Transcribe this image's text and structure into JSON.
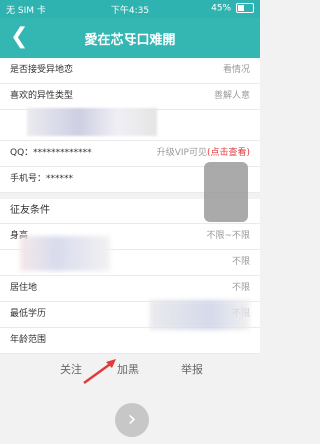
{
  "status": {
    "carrier": "无 SIM 卡",
    "time": "下午4:35",
    "battery": "45%"
  },
  "header": {
    "back_icon": "chevron-left",
    "title": "愛在芯㸦口难開"
  },
  "profile": {
    "rows": [
      {
        "label": "是否接受异地恋",
        "value": "看情况"
      },
      {
        "label": "喜欢的异性类型",
        "value": "善解人意"
      }
    ]
  },
  "contact": {
    "qq_label": "QQ：*************",
    "qq_upgrade": "升级VIP可见",
    "qq_link": "(点击查看)",
    "phone_label": "手机号：******"
  },
  "criteria": {
    "title": "征友条件",
    "rows": [
      {
        "label": "身高",
        "value": "不限~不限"
      },
      {
        "label": "",
        "value": "不限"
      },
      {
        "label": "居住地",
        "value": "不限"
      },
      {
        "label": "最低学历",
        "value": "不限"
      },
      {
        "label": "年龄范围",
        "value": ""
      }
    ]
  },
  "actions": {
    "follow": "关注",
    "block": "加黑",
    "report": "举报"
  },
  "colors": {
    "header": "#34b6b2",
    "accent_red": "#e03b3b"
  }
}
